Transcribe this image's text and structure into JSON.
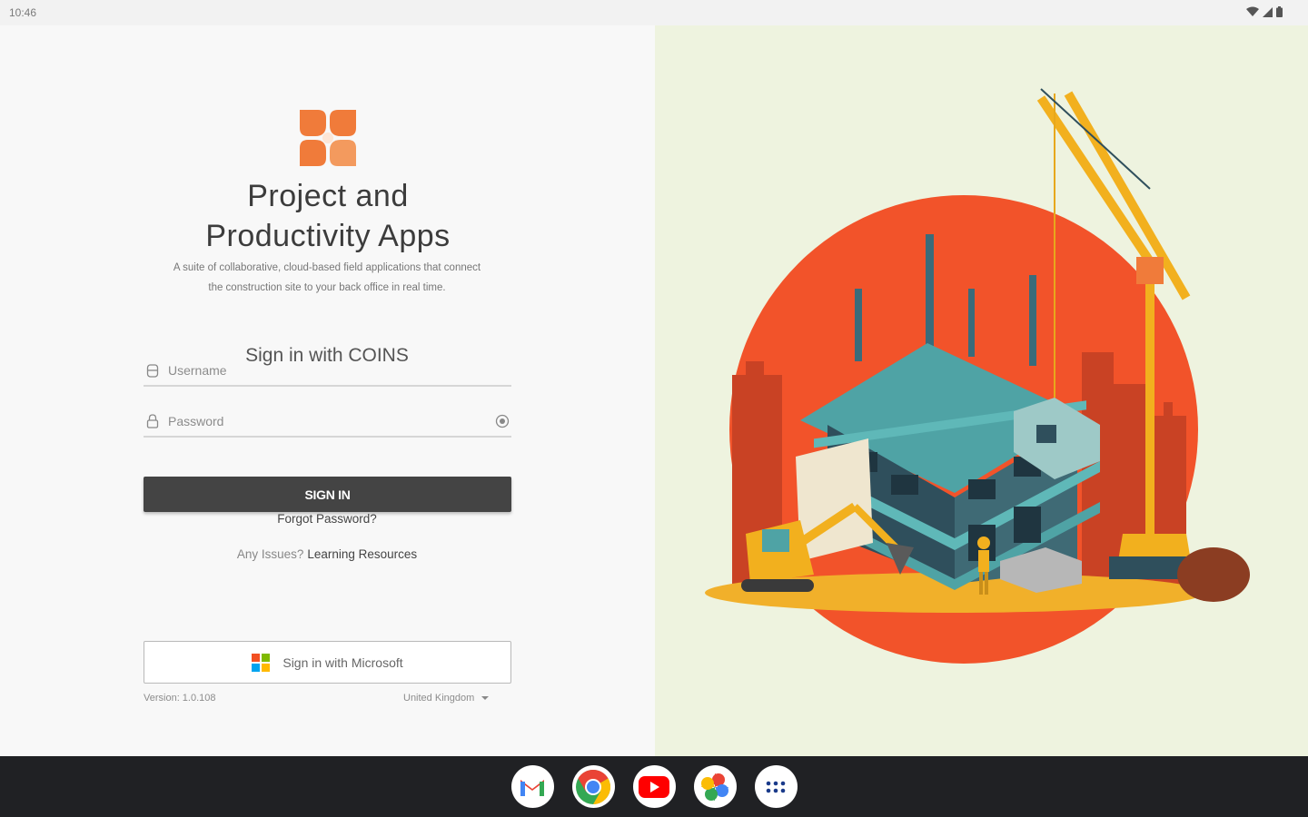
{
  "status_bar": {
    "time": "10:46"
  },
  "app": {
    "title_line1": "Project and",
    "title_line2": "Productivity Apps",
    "description_line1": "A suite of collaborative, cloud-based field applications that connect",
    "description_line2": "the construction site to your back office in real time."
  },
  "signin": {
    "heading": "Sign in with COINS",
    "username_placeholder": "Username",
    "password_placeholder": "Password",
    "button_label": "SIGN IN",
    "forgot_password": "Forgot Password?",
    "issues_label": "Any Issues?",
    "learning_resources": "Learning Resources",
    "microsoft_label": "Sign in with Microsoft"
  },
  "footer": {
    "version": "Version: 1.0.108",
    "region": "United Kingdom"
  },
  "taskbar": {
    "apps": [
      "gmail-icon",
      "chrome-icon",
      "youtube-icon",
      "photos-icon",
      "app-drawer-icon"
    ]
  },
  "colors": {
    "brand_orange": "#f07b3a",
    "button_dark": "#444444",
    "illustration_bg": "#eef3df",
    "sun_red": "#f2532a"
  }
}
